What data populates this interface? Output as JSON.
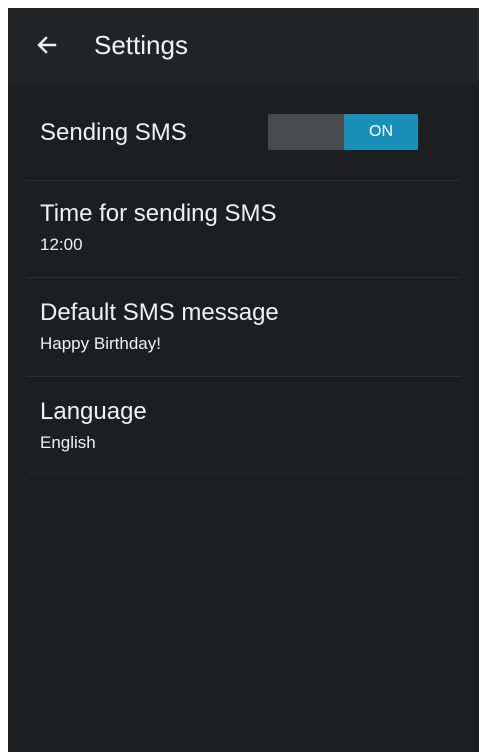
{
  "action_bar": {
    "title": "Settings",
    "back_icon": "arrow-left-icon"
  },
  "settings": {
    "sending_sms": {
      "label": "Sending SMS",
      "toggle_state": "ON",
      "enabled": true,
      "accent_color": "#1a8fba"
    },
    "time_for_sending_sms": {
      "label": "Time for sending SMS",
      "value": "12:00"
    },
    "default_sms_message": {
      "label": "Default SMS message",
      "value": "Happy Birthday!"
    },
    "language": {
      "label": "Language",
      "value": "English"
    }
  },
  "colors": {
    "background": "#1d1e20",
    "action_bar": "#222325",
    "text": "#f0f0f0",
    "toggle_off": "#4a4b4e",
    "toggle_on": "#1a8fba"
  }
}
